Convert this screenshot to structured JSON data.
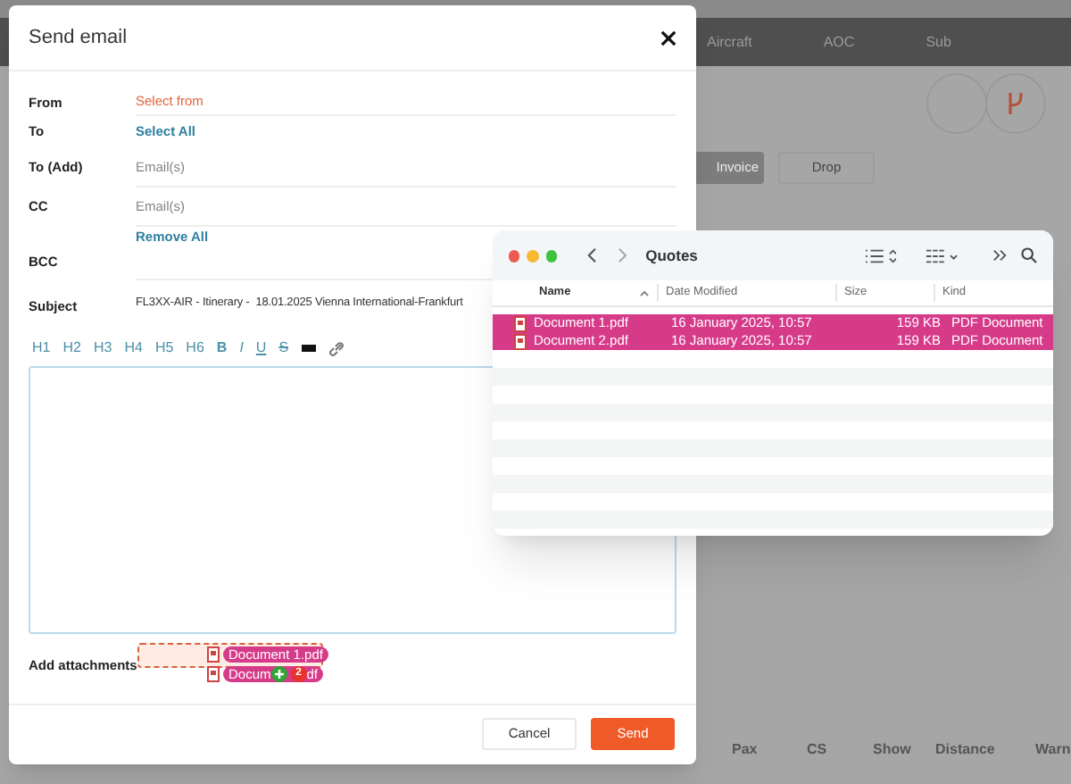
{
  "background": {
    "nav_tabs": [
      "Aircraft",
      "AOC",
      "Sub"
    ],
    "buttons": [
      "Invoice",
      "Drop"
    ],
    "columns": [
      "Pax",
      "CS",
      "Show",
      "Distance",
      "Warn"
    ]
  },
  "dialog": {
    "title": "Send email",
    "fields": [
      {
        "kind": "link",
        "label": "From",
        "value": "Select from"
      },
      {
        "kind": "action",
        "label": "To",
        "value": "Select All"
      },
      {
        "kind": "input",
        "label": "To (Add)",
        "placeholder": "Email(s)"
      },
      {
        "kind": "input",
        "label": "CC",
        "placeholder": "Email(s)"
      },
      {
        "kind": "actionbelow",
        "label": "BCC",
        "value": "Remove All"
      },
      {
        "kind": "text",
        "label": "Subject",
        "value": "FL3XX-AIR - Itinerary -  18.01.2025 Vienna International-Frankfurt"
      }
    ],
    "toolbar": [
      "H1",
      "H2",
      "H3",
      "H4",
      "H5",
      "H6",
      "B",
      "I",
      "U",
      "S"
    ],
    "attachments_label": "Add attachments",
    "buttons": [
      {
        "label": "Cancel",
        "kind": "secondary"
      },
      {
        "label": "Send",
        "kind": "primary"
      }
    ]
  },
  "drag": {
    "items": [
      "Document 1.pdf",
      "Docum"
    ],
    "tail": "df",
    "count": "2"
  },
  "finder": {
    "title": "Quotes",
    "columns": [
      "Name",
      "Date Modified",
      "Size",
      "Kind"
    ],
    "rows": [
      {
        "name": "Document 1.pdf",
        "date": "16 January 2025, 10:57",
        "size": "159 KB",
        "kind": "PDF Document",
        "selected": true
      },
      {
        "name": "Document 2.pdf",
        "date": "16 January 2025, 10:57",
        "size": "159 KB",
        "kind": "PDF Document",
        "selected": true
      }
    ]
  }
}
